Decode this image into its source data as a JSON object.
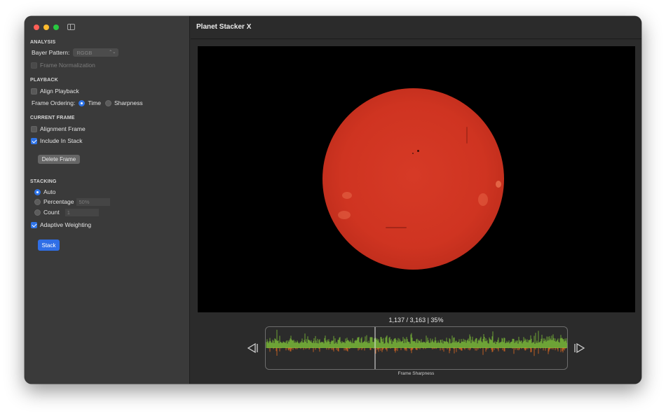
{
  "sidebar": {
    "analysis": {
      "heading": "ANALYSIS",
      "bayer_label": "Bayer Pattern:",
      "bayer_value": "RGGB",
      "frame_normalization": "Frame Normalization"
    },
    "playback": {
      "heading": "PLAYBACK",
      "align_playback": "Align Playback",
      "frame_ordering_label": "Frame Ordering:",
      "ordering_time": "Time",
      "ordering_sharpness": "Sharpness"
    },
    "current_frame": {
      "heading": "CURRENT FRAME",
      "alignment_frame": "Alignment Frame",
      "include_in_stack": "Include In Stack",
      "delete_frame": "Delete Frame"
    },
    "stacking": {
      "heading": "STACKING",
      "auto": "Auto",
      "percentage": "Percentage",
      "percentage_value": "50%",
      "count": "Count",
      "count_value": "1",
      "adaptive_weighting": "Adaptive Weighting",
      "stack_button": "Stack"
    }
  },
  "main": {
    "title": "Planet Stacker X",
    "frame_info": "1,137 / 3,163 | 35%",
    "graph_label": "Frame Sharpness",
    "playhead_position": 0.36
  },
  "colors": {
    "accent": "#2f74e8",
    "sun": "#cf3421",
    "graph_green": "#7fc23a",
    "graph_orange": "#e06a22"
  }
}
